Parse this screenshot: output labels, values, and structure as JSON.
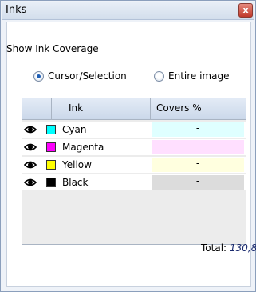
{
  "window": {
    "title": "Inks",
    "close_glyph": "x"
  },
  "section": {
    "label": "Show Ink Coverage"
  },
  "options": [
    {
      "label": "Cursor/Selection",
      "checked": true
    },
    {
      "label": "Entire image",
      "checked": false
    }
  ],
  "table": {
    "headers": [
      "Ink",
      "Covers %"
    ],
    "rows": [
      {
        "name": "Cyan",
        "swatch": "#00ffff",
        "cover_bg": "#dfffff",
        "cover": "-"
      },
      {
        "name": "Magenta",
        "swatch": "#ff00ff",
        "cover_bg": "#ffdfff",
        "cover": "-"
      },
      {
        "name": "Yellow",
        "swatch": "#ffff00",
        "cover_bg": "#ffffdf",
        "cover": "-"
      },
      {
        "name": "Black",
        "swatch": "#000000",
        "cover_bg": "#dcdcdc",
        "cover": "-"
      }
    ]
  },
  "total": {
    "label": "Total:",
    "value": "130,8"
  }
}
